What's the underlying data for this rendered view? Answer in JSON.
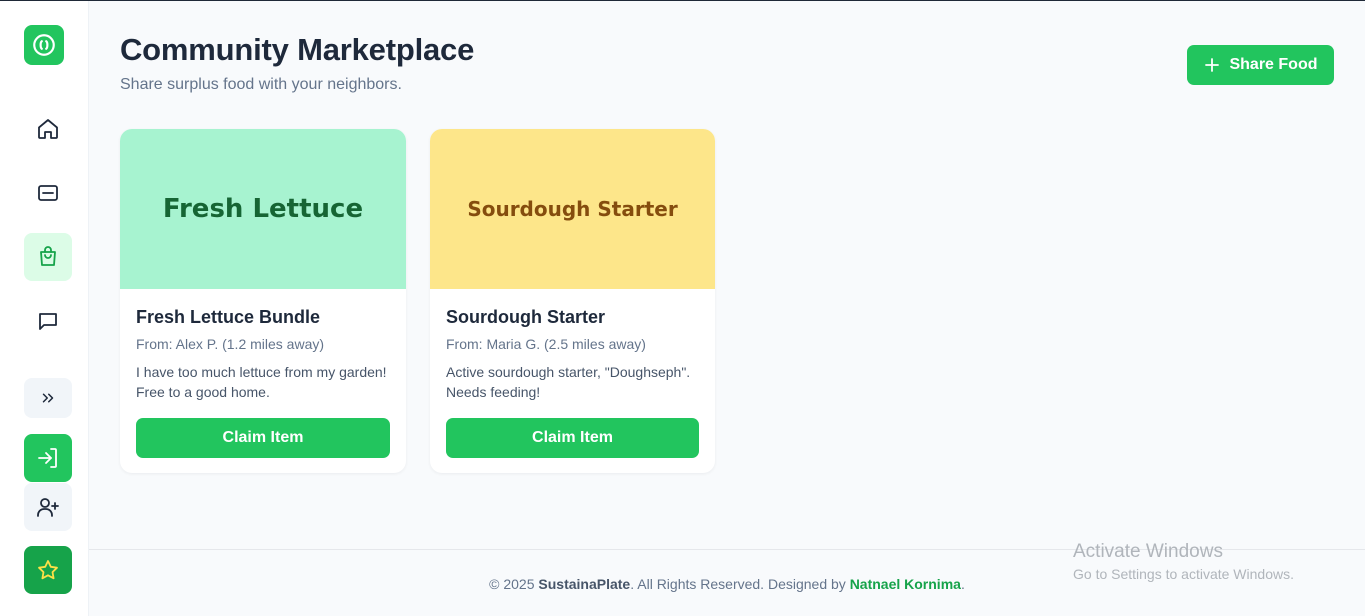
{
  "sidebar": {
    "logo_icon": "recycle-leaf-icon",
    "items": [
      {
        "name": "home",
        "icon": "home-icon"
      },
      {
        "name": "dashboard",
        "icon": "minus-square-icon"
      },
      {
        "name": "marketplace",
        "icon": "shopping-bag-icon",
        "active": true
      },
      {
        "name": "messages",
        "icon": "message-square-icon"
      },
      {
        "name": "expand",
        "icon": "chevrons-right-icon"
      },
      {
        "name": "login",
        "icon": "log-in-icon"
      },
      {
        "name": "register",
        "icon": "user-plus-icon"
      },
      {
        "name": "favorites",
        "icon": "star-icon"
      }
    ]
  },
  "header": {
    "title": "Community Marketplace",
    "subtitle": "Share surplus food with your neighbors.",
    "share_button_label": "Share Food"
  },
  "listings": [
    {
      "image_text": "Fresh Lettuce",
      "title": "Fresh Lettuce Bundle",
      "from": "From: Alex P. (1.2 miles away)",
      "description": "I have too much lettuce from my garden! Free to a good home.",
      "button_label": "Claim Item"
    },
    {
      "image_text": "Sourdough Starter",
      "title": "Sourdough Starter",
      "from": "From: Maria G. (2.5 miles away)",
      "description": "Active sourdough starter, \"Doughseph\". Needs feeding!",
      "button_label": "Claim Item"
    }
  ],
  "footer": {
    "prefix": "© 2025 ",
    "brand": "SustainaPlate",
    "middle": ". All Rights Reserved. Designed by ",
    "author": "Natnael Kornima",
    "suffix": "."
  },
  "watermark": {
    "title": "Activate Windows",
    "subtitle": "Go to Settings to activate Windows."
  },
  "colors": {
    "accent": "#22c55e",
    "accent_dark": "#16a34a",
    "lettuce_bg": "#a7f3d0",
    "sourdough_bg": "#fde68a"
  }
}
